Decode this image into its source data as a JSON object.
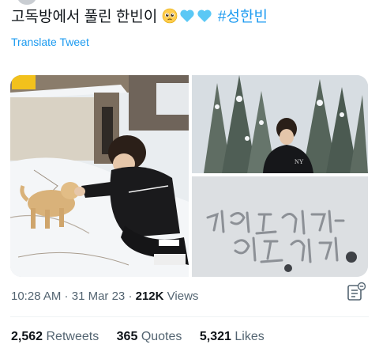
{
  "tweet": {
    "text": "고독방에서 풀린 한빈이",
    "emojis": [
      "pleading-face-icon",
      "light-blue-heart-icon",
      "light-blue-heart-icon"
    ],
    "hashtag": "#성한빈",
    "translate_label": "Translate Tweet"
  },
  "meta": {
    "time": "10:28 AM",
    "separator1": " · ",
    "date": "31 Mar 23",
    "separator2": " · ",
    "views_count": "212K",
    "views_label": "Views"
  },
  "stats": {
    "retweets_count": "2,562",
    "retweets_label": "Retweets",
    "quotes_count": "365",
    "quotes_label": "Quotes",
    "likes_count": "5,321",
    "likes_label": "Likes"
  },
  "colors": {
    "link": "#1d9bf0",
    "secondary_text": "#536471",
    "heart": "#5bc8f5"
  }
}
